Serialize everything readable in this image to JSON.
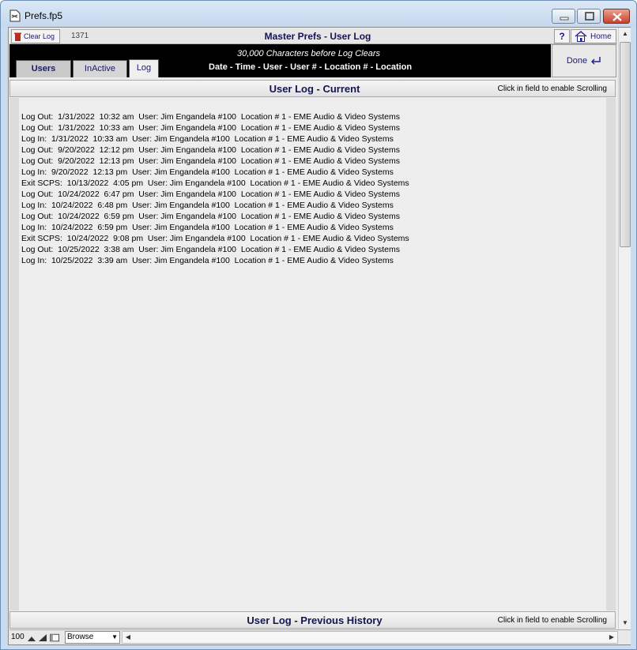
{
  "window": {
    "title": "Prefs.fp5"
  },
  "toolbar": {
    "clear_log": "Clear Log",
    "record_count": "1371",
    "title": "Master Prefs - User Log",
    "help": "?",
    "home": "Home"
  },
  "header": {
    "subtitle": "30,000 Characters before Log Clears",
    "columns": "Date - Time - User - User # - Location # - Location",
    "done": "Done"
  },
  "tabs": [
    {
      "label": "Users",
      "active": false
    },
    {
      "label": "InActive",
      "active": false
    },
    {
      "label": "Log",
      "active": true
    }
  ],
  "current": {
    "title": "User Log - Current",
    "hint": "Click in field to enable Scrolling",
    "lines": [
      "Log Out:  1/31/2022  10:32 am  User: Jim Engandela #100  Location # 1 - EME Audio & Video Systems",
      "Log Out:  1/31/2022  10:33 am  User: Jim Engandela #100  Location # 1 - EME Audio & Video Systems",
      "Log In:  1/31/2022  10:33 am  User: Jim Engandela #100  Location # 1 - EME Audio & Video Systems",
      "Log Out:  9/20/2022  12:12 pm  User: Jim Engandela #100  Location # 1 - EME Audio & Video Systems",
      "Log Out:  9/20/2022  12:13 pm  User: Jim Engandela #100  Location # 1 - EME Audio & Video Systems",
      "Log In:  9/20/2022  12:13 pm  User: Jim Engandela #100  Location # 1 - EME Audio & Video Systems",
      "Exit SCPS:  10/13/2022  4:05 pm  User: Jim Engandela #100  Location # 1 - EME Audio & Video Systems",
      "Log Out:  10/24/2022  6:47 pm  User: Jim Engandela #100  Location # 1 - EME Audio & Video Systems",
      "Log In:  10/24/2022  6:48 pm  User: Jim Engandela #100  Location # 1 - EME Audio & Video Systems",
      "Log Out:  10/24/2022  6:59 pm  User: Jim Engandela #100  Location # 1 - EME Audio & Video Systems",
      "Log In:  10/24/2022  6:59 pm  User: Jim Engandela #100  Location # 1 - EME Audio & Video Systems",
      "Exit SCPS:  10/24/2022  9:08 pm  User: Jim Engandela #100  Location # 1 - EME Audio & Video Systems",
      "Log Out:  10/25/2022  3:38 am  User: Jim Engandela #100  Location # 1 - EME Audio & Video Systems",
      "Log In:  10/25/2022  3:39 am  User: Jim Engandela #100  Location # 1 - EME Audio & Video Systems"
    ]
  },
  "history": {
    "title": "User Log - Previous History",
    "hint": "Click in field to enable Scrolling"
  },
  "status": {
    "zoom": "100",
    "mode": "Browse"
  },
  "icons": [
    "document-icon",
    "trash-icon",
    "home-icon",
    "done-return-icon",
    "minimize-icon",
    "maximize-icon",
    "close-icon",
    "chevron-down-icon",
    "arrow-left-icon",
    "arrow-right-icon",
    "arrow-up-icon",
    "arrow-down-icon"
  ]
}
